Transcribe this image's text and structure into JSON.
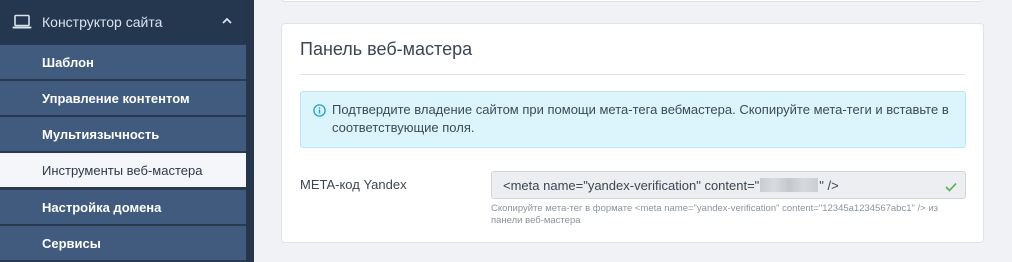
{
  "sidebar": {
    "header": {
      "label": "Конструктор сайта",
      "icon": "laptop-icon",
      "chevron": "chevron-up-icon"
    },
    "items": [
      {
        "label": "Шаблон",
        "active": false
      },
      {
        "label": "Управление контентом",
        "active": false
      },
      {
        "label": "Мультиязычность",
        "active": false
      },
      {
        "label": "Инструменты веб-мастера",
        "active": true
      },
      {
        "label": "Настройка домена",
        "active": false
      },
      {
        "label": "Сервисы",
        "active": false
      }
    ]
  },
  "panel": {
    "title": "Панель веб-мастера",
    "alert": {
      "icon": "info-icon",
      "text": "Подтвердите владение сайтом при помощи мета-тега вебмастера. Скопируйте мета-теги и вставьте в соответствующие поля."
    },
    "yandex": {
      "label": "META-код Yandex",
      "value_prefix": "<meta name=\"yandex-verification\" content=\"",
      "value_suffix": "\" />",
      "status_icon": "check-icon",
      "hint": "Скопируйте мета-тег в формате <meta name=\"yandex-verification\" content=\"12345a1234567abc1\" /> из панели веб-мастера"
    }
  },
  "colors": {
    "sidebar_bg": "#2b3a4f",
    "nav_item_bg": "#405b7e",
    "nav_active_bg": "#f4f6f9",
    "alert_bg": "#dcf4fb",
    "alert_icon": "#1aa3c8",
    "check": "#4caf50"
  }
}
